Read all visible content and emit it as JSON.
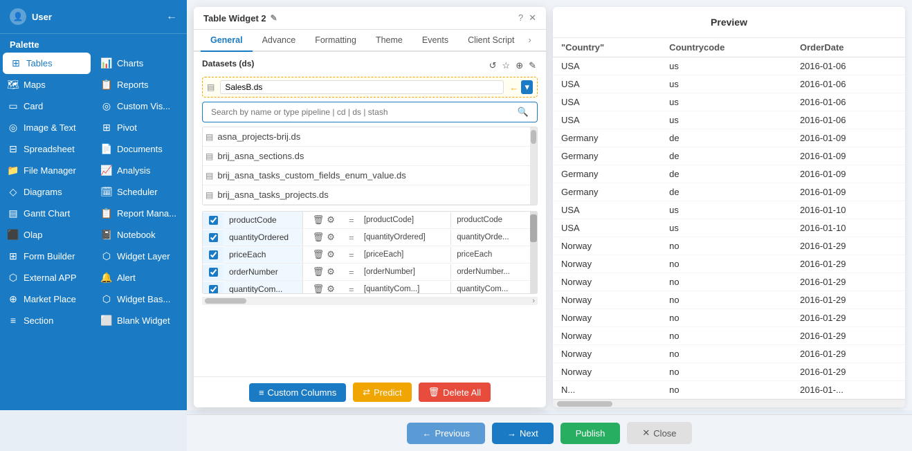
{
  "sidebar": {
    "header": {
      "title": "User",
      "back_icon": "←"
    },
    "palette_label": "Palette",
    "col1_items": [
      {
        "label": "Tables",
        "icon": "⊞",
        "active": true
      },
      {
        "label": "Maps",
        "icon": "🗺"
      },
      {
        "label": "Card",
        "icon": "▭"
      },
      {
        "label": "Image & Text",
        "icon": "◎"
      },
      {
        "label": "Spreadsheet",
        "icon": "⊟"
      },
      {
        "label": "File Manager",
        "icon": "📁"
      },
      {
        "label": "Diagrams",
        "icon": "◇"
      },
      {
        "label": "Gantt Chart",
        "icon": "▤"
      },
      {
        "label": "Olap",
        "icon": "⬛"
      },
      {
        "label": "Form Builder",
        "icon": "⊞"
      },
      {
        "label": "External APP",
        "icon": "⬡"
      },
      {
        "label": "Market Place",
        "icon": "⊕"
      },
      {
        "label": "Section",
        "icon": "≡"
      }
    ],
    "col2_items": [
      {
        "label": "Charts",
        "icon": "📊"
      },
      {
        "label": "Reports",
        "icon": "📋"
      },
      {
        "label": "Custom Vis...",
        "icon": "◎"
      },
      {
        "label": "Pivot",
        "icon": "⊞"
      },
      {
        "label": "Documents",
        "icon": "📄"
      },
      {
        "label": "Analysis",
        "icon": "📈"
      },
      {
        "label": "Scheduler",
        "icon": "🗓"
      },
      {
        "label": "Report Mana...",
        "icon": "📋"
      },
      {
        "label": "Notebook",
        "icon": "📓"
      },
      {
        "label": "Widget Layer",
        "icon": "⬡"
      },
      {
        "label": "Alert",
        "icon": "🔔"
      },
      {
        "label": "Widget Bas...",
        "icon": "⬡"
      },
      {
        "label": "Blank Widget",
        "icon": "⬜"
      }
    ]
  },
  "dialog": {
    "title": "Table Widget 2",
    "edit_icon": "✎",
    "controls": [
      "?",
      "✕"
    ],
    "tabs": [
      "General",
      "Advance",
      "Formatting",
      "Theme",
      "Events",
      "Client Script",
      "›"
    ],
    "active_tab": "General",
    "datasets_label": "Datasets (ds)",
    "datasets_icons": [
      "↺",
      "☆",
      "⊕",
      "✎"
    ],
    "selected_dataset": "SalesB.ds",
    "arrow_icon": "←",
    "search_placeholder": "Search by name or type pipeline | cd | ds | stash",
    "ds_items": [
      "asna_projects-brij.ds",
      "brij_asna_sections.ds",
      "brij_asna_tasks_custom_fields_enum_value.ds",
      "brij_asna_tasks_projects.ds"
    ],
    "columns": [
      {
        "checked": true,
        "name": "productCode",
        "expr": "[productCode]",
        "alias": "productCode"
      },
      {
        "checked": true,
        "name": "quantityOrdered",
        "expr": "[quantityOrdered]",
        "alias": "quantityOrde..."
      },
      {
        "checked": true,
        "name": "priceEach",
        "expr": "[priceEach]",
        "alias": "priceEach"
      },
      {
        "checked": true,
        "name": "orderNumber",
        "expr": "[orderNumber]",
        "alias": "orderNumber..."
      },
      {
        "checked": true,
        "name": "quantityCom...",
        "expr": "[quantityCom...]",
        "alias": "quantityCom..."
      }
    ],
    "buttons": {
      "custom_columns": "Custom Columns",
      "predict": "Predict",
      "delete_all": "Delete All"
    },
    "nav": {
      "previous": "Previous",
      "next": "Next",
      "publish": "Publish",
      "close": "Close"
    }
  },
  "preview": {
    "title": "Preview",
    "columns": [
      "\"Country\"",
      "Countrycode",
      "OrderDate"
    ],
    "rows": [
      {
        "country": "USA",
        "code": "us",
        "date": "2016-01-06"
      },
      {
        "country": "USA",
        "code": "us",
        "date": "2016-01-06"
      },
      {
        "country": "USA",
        "code": "us",
        "date": "2016-01-06"
      },
      {
        "country": "USA",
        "code": "us",
        "date": "2016-01-06"
      },
      {
        "country": "Germany",
        "code": "de",
        "date": "2016-01-09"
      },
      {
        "country": "Germany",
        "code": "de",
        "date": "2016-01-09"
      },
      {
        "country": "Germany",
        "code": "de",
        "date": "2016-01-09"
      },
      {
        "country": "Germany",
        "code": "de",
        "date": "2016-01-09"
      },
      {
        "country": "USA",
        "code": "us",
        "date": "2016-01-10"
      },
      {
        "country": "USA",
        "code": "us",
        "date": "2016-01-10"
      },
      {
        "country": "Norway",
        "code": "no",
        "date": "2016-01-29"
      },
      {
        "country": "Norway",
        "code": "no",
        "date": "2016-01-29"
      },
      {
        "country": "Norway",
        "code": "no",
        "date": "2016-01-29"
      },
      {
        "country": "Norway",
        "code": "no",
        "date": "2016-01-29"
      },
      {
        "country": "Norway",
        "code": "no",
        "date": "2016-01-29"
      },
      {
        "country": "Norway",
        "code": "no",
        "date": "2016-01-29"
      },
      {
        "country": "Norway",
        "code": "no",
        "date": "2016-01-29"
      },
      {
        "country": "Norway",
        "code": "no",
        "date": "2016-01-29"
      },
      {
        "country": "N...",
        "code": "no",
        "date": "2016-01-..."
      }
    ]
  }
}
